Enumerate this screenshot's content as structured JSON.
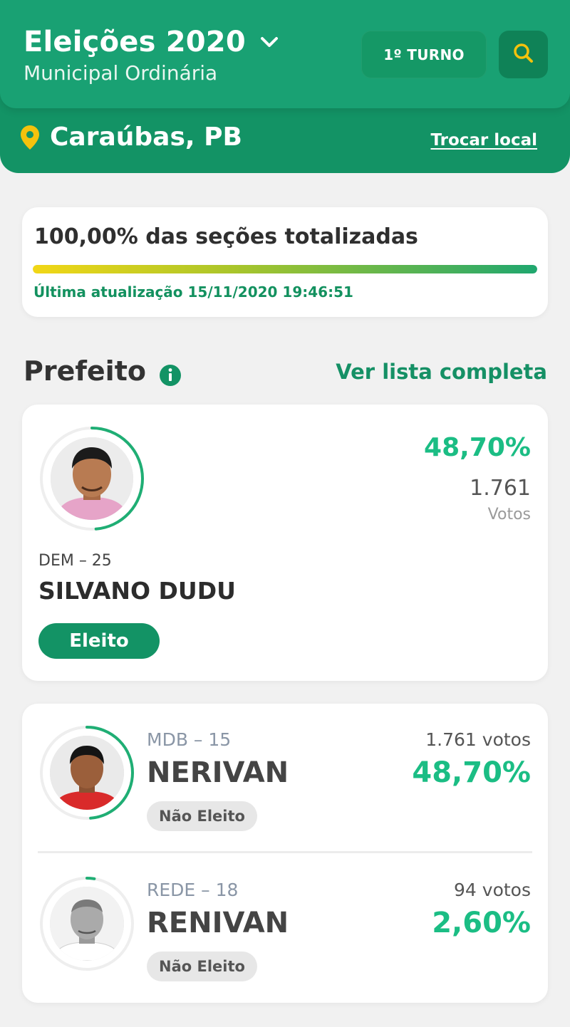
{
  "header": {
    "title": "Eleições 2020",
    "subtitle": "Municipal Ordinária",
    "turno_label": "1º TURNO",
    "location": "Caraúbas, PB",
    "change_location_label": "Trocar local",
    "brand_color": "#19a173",
    "accent_color": "#f4c20d"
  },
  "progress": {
    "title": "100,00% das seções totalizadas",
    "fraction": 1.0,
    "updated": "Última atualização 15/11/2020 19:46:51"
  },
  "section": {
    "title": "Prefeito",
    "view_all_label": "Ver lista completa"
  },
  "winner": {
    "party": "DEM – 25",
    "name": "SILVANO DUDU",
    "percent": "48,70%",
    "votes": "1.761",
    "votes_label": "Votos",
    "status": "Eleito",
    "vote_share": 0.487
  },
  "candidates": [
    {
      "party": "MDB – 15",
      "name": "NERIVAN",
      "votes": "1.761 votos",
      "percent": "48,70%",
      "status": "Não Eleito",
      "vote_share": 0.487
    },
    {
      "party": "REDE – 18",
      "name": "RENIVAN",
      "votes": "94 votos",
      "percent": "2,60%",
      "status": "Não Eleito",
      "vote_share": 0.026
    }
  ]
}
